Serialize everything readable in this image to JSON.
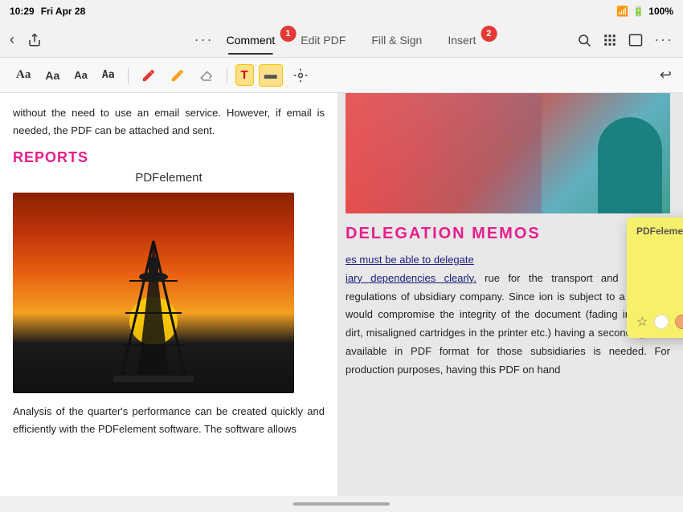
{
  "statusBar": {
    "time": "10:29",
    "date": "Fri Apr 28",
    "wifi": "📶",
    "battery": "100%"
  },
  "topToolbar": {
    "tabs": [
      {
        "id": "comment",
        "label": "Comment",
        "active": true,
        "badge": "1"
      },
      {
        "id": "edit-pdf",
        "label": "Edit PDF",
        "active": false
      },
      {
        "id": "fill-sign",
        "label": "Fill & Sign",
        "active": false
      },
      {
        "id": "insert",
        "label": "Insert",
        "active": false,
        "badge": "2"
      }
    ],
    "dotsLabel": "···",
    "undoLabel": "↩"
  },
  "secondaryToolbar": {
    "buttons": [
      {
        "id": "text-aa-serif",
        "label": "Aa",
        "style": "serif",
        "active": false
      },
      {
        "id": "text-aa-sans",
        "label": "Aa",
        "style": "sans",
        "active": false
      },
      {
        "id": "text-aa-small",
        "label": "Aa",
        "style": "small",
        "active": false
      },
      {
        "id": "text-aa-mono",
        "label": "Aa",
        "style": "mono",
        "active": false
      }
    ],
    "icons": [
      {
        "id": "pen-red",
        "symbol": "✏️",
        "color": "#e53935"
      },
      {
        "id": "eraser",
        "symbol": "✏️",
        "color": "#f4a020"
      },
      {
        "id": "pencil",
        "symbol": "✏️",
        "color": "#999"
      }
    ],
    "highlight-T": "T",
    "highlight-box": "▬",
    "stamp": "⊕"
  },
  "leftPanel": {
    "introText": "without the need to use an email service. However, if email is needed, the PDF can be attached and sent.",
    "reportsTitle": "REPORTS",
    "pdfelementLabel": "PDFelement",
    "analysisText": "Analysis of the quarter's performance can be created quickly and efficiently with the PDFelement software. The software allows"
  },
  "rightPanel": {
    "delegationTitle": "DELEGATION MEMOS",
    "bodyText": "es must be able to delegate iary dependencies clearly. rue for the transport and and regulations of ubsidiary company. Since ion is subject to a variety n would compromise the integrity of the document (fading ink, spills, dirt, misaligned cartridges in the printer etc.) having a secondary form available in PDF format for those subsidiaries is needed. For production purposes, having this PDF on hand"
  },
  "stickyNote": {
    "header": "PDFelement",
    "body": "",
    "colors": [
      {
        "id": "white",
        "hex": "#ffffff"
      },
      {
        "id": "peach",
        "hex": "#f4a46a"
      },
      {
        "id": "blue",
        "hex": "#5ab4f0"
      },
      {
        "id": "green",
        "hex": "#5ecf6a"
      },
      {
        "id": "purple",
        "hex": "#9c5ad4"
      },
      {
        "id": "pink",
        "hex": "#e84090"
      }
    ],
    "activeColor": "white",
    "bookmarkIcon": "★"
  },
  "bottomBar": {
    "homeIndicator": true
  }
}
